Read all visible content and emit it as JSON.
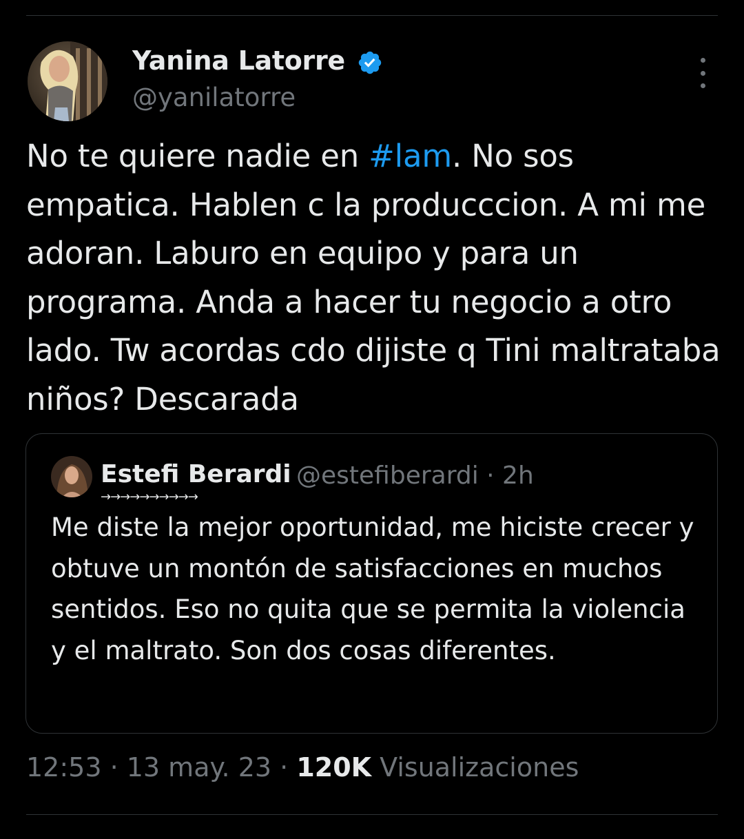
{
  "author": {
    "name": "Yanina Latorre",
    "handle": "@yanilatorre",
    "verified": true
  },
  "tweet": {
    "text_parts": [
      "No te quiere nadie en ",
      "#lam",
      ". No sos empatica. Hablen c la producccion. A mi me adoran. Laburo en equipo y para un programa. Anda a hacer tu negocio a otro lado. Tw acordas cdo dijiste q Tini maltrataba niños? Descarada"
    ]
  },
  "quoted": {
    "name": "Estefi Berardi",
    "name_decoration": "→→→→→→→→→→",
    "handle_time": "@estefiberardi · 2h",
    "text": "Me diste la mejor oportunidad, me hiciste crecer y obtuve un montón de satisfacciones en muchos sentidos. Eso no quita que se permita la violencia y el maltrato. Son dos cosas diferentes."
  },
  "meta": {
    "time_date": "12:53 · 13 may. 23 · ",
    "views_count": "120K",
    "views_label": " Visualizaciones"
  },
  "colors": {
    "background": "#000000",
    "text": "#e7e9ea",
    "secondary": "#71767b",
    "accent": "#1d9bf0",
    "border": "#2f3336"
  },
  "icons": {
    "verified": "verified-badge-icon",
    "more": "more-options-icon"
  }
}
